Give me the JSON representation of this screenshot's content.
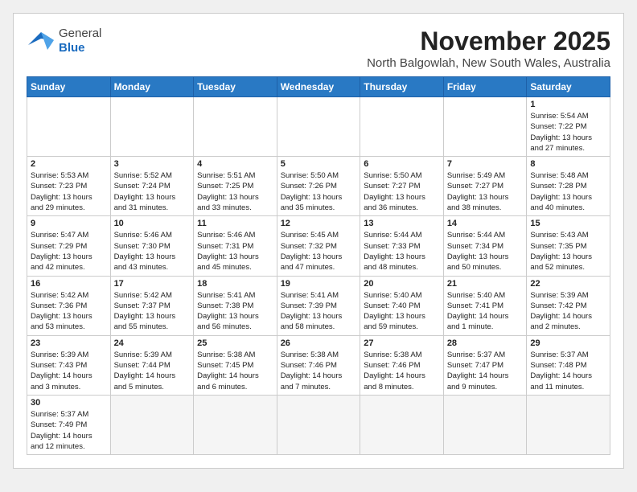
{
  "header": {
    "logo_general": "General",
    "logo_blue": "Blue",
    "month": "November 2025",
    "location": "North Balgowlah, New South Wales, Australia"
  },
  "weekdays": [
    "Sunday",
    "Monday",
    "Tuesday",
    "Wednesday",
    "Thursday",
    "Friday",
    "Saturday"
  ],
  "weeks": [
    [
      {
        "day": "",
        "info": ""
      },
      {
        "day": "",
        "info": ""
      },
      {
        "day": "",
        "info": ""
      },
      {
        "day": "",
        "info": ""
      },
      {
        "day": "",
        "info": ""
      },
      {
        "day": "",
        "info": ""
      },
      {
        "day": "1",
        "info": "Sunrise: 5:54 AM\nSunset: 7:22 PM\nDaylight: 13 hours\nand 27 minutes."
      }
    ],
    [
      {
        "day": "2",
        "info": "Sunrise: 5:53 AM\nSunset: 7:23 PM\nDaylight: 13 hours\nand 29 minutes."
      },
      {
        "day": "3",
        "info": "Sunrise: 5:52 AM\nSunset: 7:24 PM\nDaylight: 13 hours\nand 31 minutes."
      },
      {
        "day": "4",
        "info": "Sunrise: 5:51 AM\nSunset: 7:25 PM\nDaylight: 13 hours\nand 33 minutes."
      },
      {
        "day": "5",
        "info": "Sunrise: 5:50 AM\nSunset: 7:26 PM\nDaylight: 13 hours\nand 35 minutes."
      },
      {
        "day": "6",
        "info": "Sunrise: 5:50 AM\nSunset: 7:27 PM\nDaylight: 13 hours\nand 36 minutes."
      },
      {
        "day": "7",
        "info": "Sunrise: 5:49 AM\nSunset: 7:27 PM\nDaylight: 13 hours\nand 38 minutes."
      },
      {
        "day": "8",
        "info": "Sunrise: 5:48 AM\nSunset: 7:28 PM\nDaylight: 13 hours\nand 40 minutes."
      }
    ],
    [
      {
        "day": "9",
        "info": "Sunrise: 5:47 AM\nSunset: 7:29 PM\nDaylight: 13 hours\nand 42 minutes."
      },
      {
        "day": "10",
        "info": "Sunrise: 5:46 AM\nSunset: 7:30 PM\nDaylight: 13 hours\nand 43 minutes."
      },
      {
        "day": "11",
        "info": "Sunrise: 5:46 AM\nSunset: 7:31 PM\nDaylight: 13 hours\nand 45 minutes."
      },
      {
        "day": "12",
        "info": "Sunrise: 5:45 AM\nSunset: 7:32 PM\nDaylight: 13 hours\nand 47 minutes."
      },
      {
        "day": "13",
        "info": "Sunrise: 5:44 AM\nSunset: 7:33 PM\nDaylight: 13 hours\nand 48 minutes."
      },
      {
        "day": "14",
        "info": "Sunrise: 5:44 AM\nSunset: 7:34 PM\nDaylight: 13 hours\nand 50 minutes."
      },
      {
        "day": "15",
        "info": "Sunrise: 5:43 AM\nSunset: 7:35 PM\nDaylight: 13 hours\nand 52 minutes."
      }
    ],
    [
      {
        "day": "16",
        "info": "Sunrise: 5:42 AM\nSunset: 7:36 PM\nDaylight: 13 hours\nand 53 minutes."
      },
      {
        "day": "17",
        "info": "Sunrise: 5:42 AM\nSunset: 7:37 PM\nDaylight: 13 hours\nand 55 minutes."
      },
      {
        "day": "18",
        "info": "Sunrise: 5:41 AM\nSunset: 7:38 PM\nDaylight: 13 hours\nand 56 minutes."
      },
      {
        "day": "19",
        "info": "Sunrise: 5:41 AM\nSunset: 7:39 PM\nDaylight: 13 hours\nand 58 minutes."
      },
      {
        "day": "20",
        "info": "Sunrise: 5:40 AM\nSunset: 7:40 PM\nDaylight: 13 hours\nand 59 minutes."
      },
      {
        "day": "21",
        "info": "Sunrise: 5:40 AM\nSunset: 7:41 PM\nDaylight: 14 hours\nand 1 minute."
      },
      {
        "day": "22",
        "info": "Sunrise: 5:39 AM\nSunset: 7:42 PM\nDaylight: 14 hours\nand 2 minutes."
      }
    ],
    [
      {
        "day": "23",
        "info": "Sunrise: 5:39 AM\nSunset: 7:43 PM\nDaylight: 14 hours\nand 3 minutes."
      },
      {
        "day": "24",
        "info": "Sunrise: 5:39 AM\nSunset: 7:44 PM\nDaylight: 14 hours\nand 5 minutes."
      },
      {
        "day": "25",
        "info": "Sunrise: 5:38 AM\nSunset: 7:45 PM\nDaylight: 14 hours\nand 6 minutes."
      },
      {
        "day": "26",
        "info": "Sunrise: 5:38 AM\nSunset: 7:46 PM\nDaylight: 14 hours\nand 7 minutes."
      },
      {
        "day": "27",
        "info": "Sunrise: 5:38 AM\nSunset: 7:46 PM\nDaylight: 14 hours\nand 8 minutes."
      },
      {
        "day": "28",
        "info": "Sunrise: 5:37 AM\nSunset: 7:47 PM\nDaylight: 14 hours\nand 9 minutes."
      },
      {
        "day": "29",
        "info": "Sunrise: 5:37 AM\nSunset: 7:48 PM\nDaylight: 14 hours\nand 11 minutes."
      }
    ],
    [
      {
        "day": "30",
        "info": "Sunrise: 5:37 AM\nSunset: 7:49 PM\nDaylight: 14 hours\nand 12 minutes."
      },
      {
        "day": "",
        "info": ""
      },
      {
        "day": "",
        "info": ""
      },
      {
        "day": "",
        "info": ""
      },
      {
        "day": "",
        "info": ""
      },
      {
        "day": "",
        "info": ""
      },
      {
        "day": "",
        "info": ""
      }
    ]
  ]
}
